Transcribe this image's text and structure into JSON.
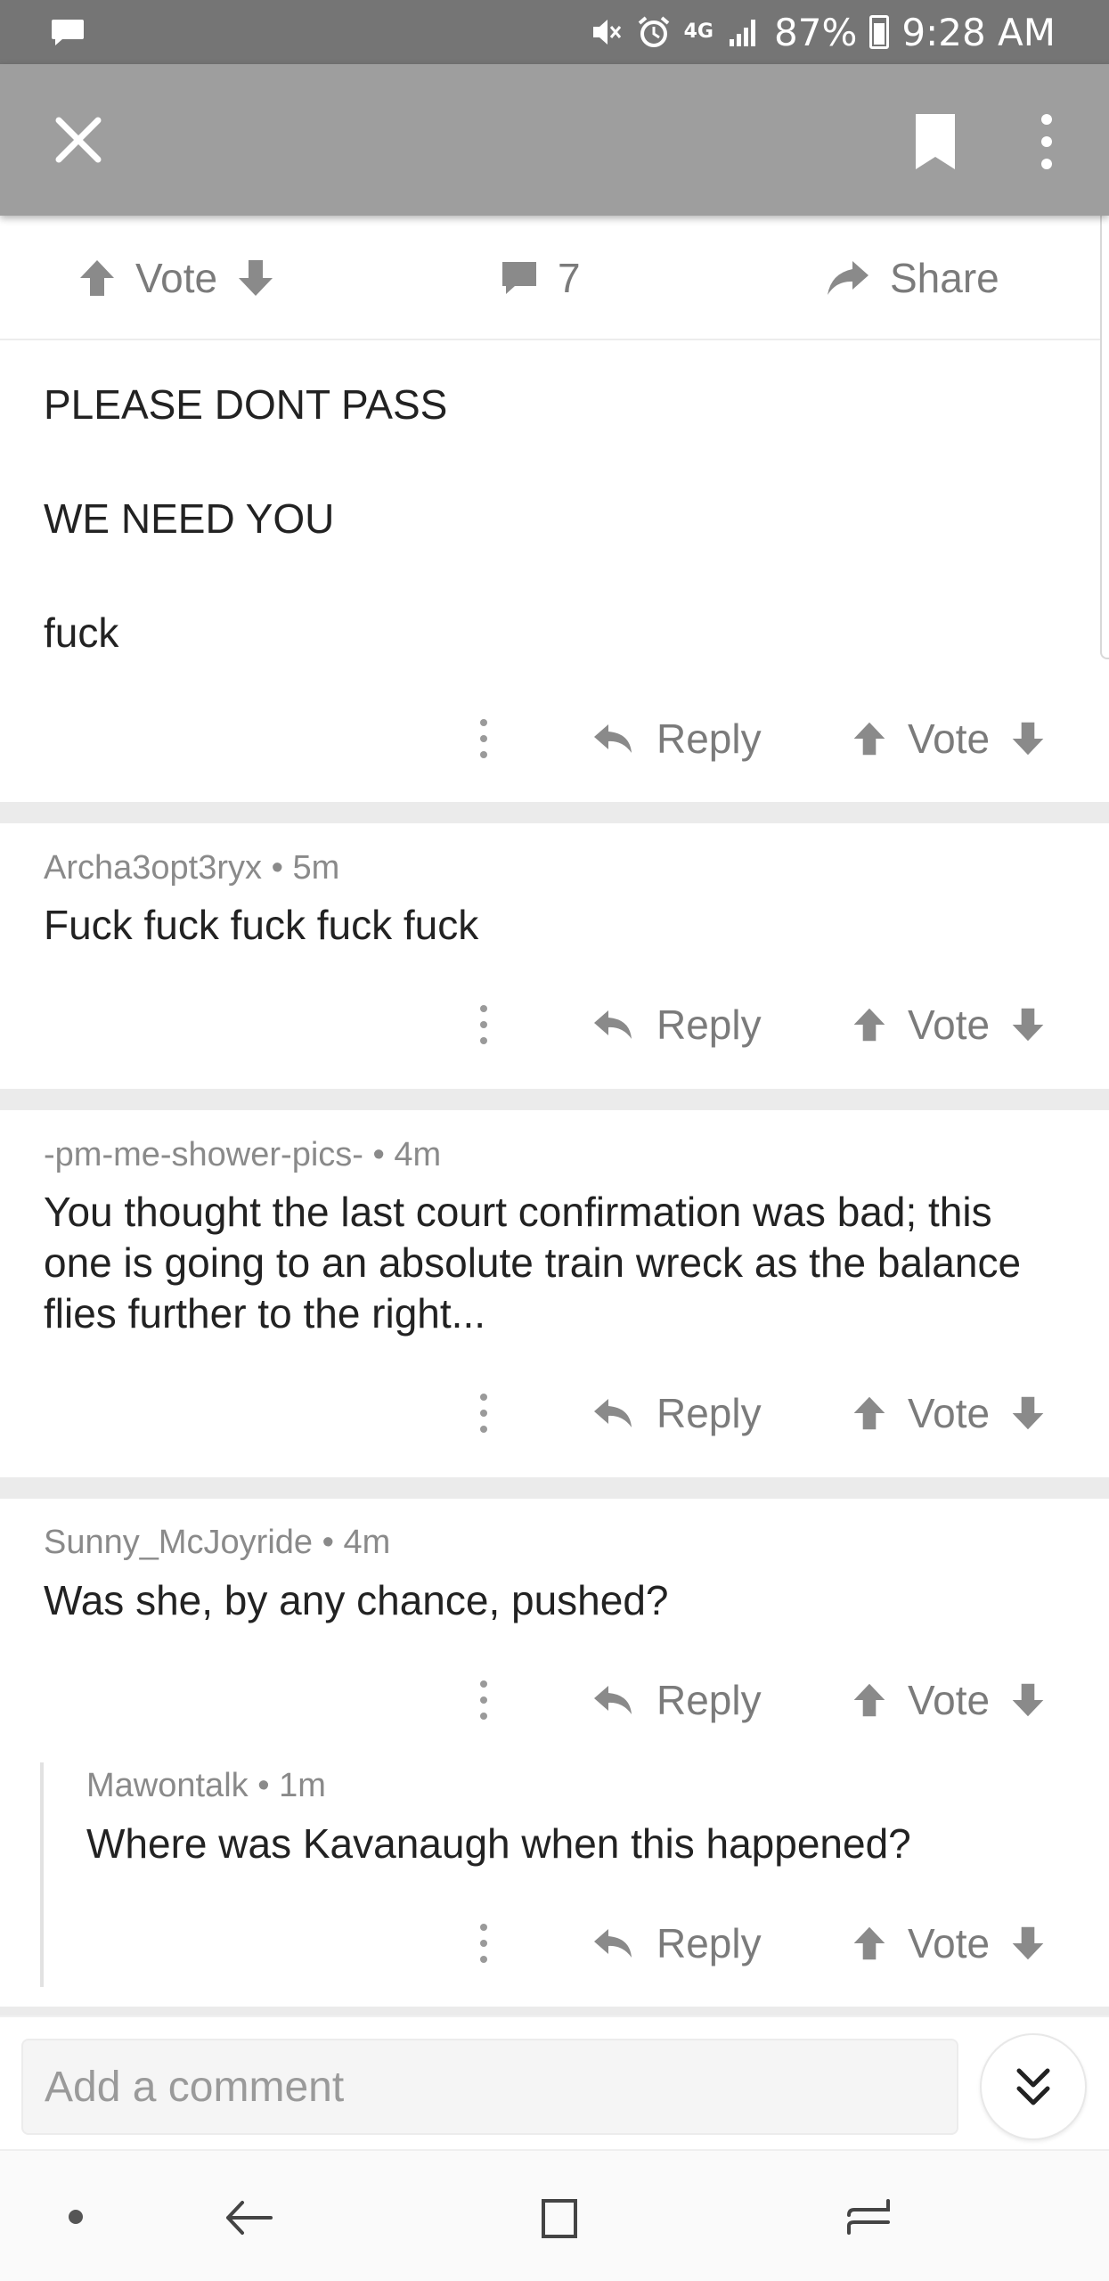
{
  "status_bar": {
    "network": "4G",
    "battery": "87%",
    "time": "9:28 AM",
    "icons": [
      "message-notification-icon",
      "mute-icon",
      "alarm-icon",
      "signal-icon",
      "battery-icon"
    ]
  },
  "app_bar": {
    "icons": [
      "close-icon",
      "bookmark-icon",
      "more-vert-icon"
    ]
  },
  "post_actions": {
    "vote_label": "Vote",
    "comment_count": "7",
    "share_label": "Share"
  },
  "post": {
    "lines": [
      "PLEASE DONT PASS",
      "WE NEED YOU",
      "fuck"
    ]
  },
  "comment_actions": {
    "reply_label": "Reply",
    "vote_label": "Vote"
  },
  "comments": [
    {
      "author": "Archa3opt3ryx",
      "age": "5m",
      "text": "Fuck fuck fuck fuck fuck"
    },
    {
      "author": "-pm-me-shower-pics-",
      "age": "4m",
      "text": "You thought the last court confirmation was bad; this one is going to an absolute train wreck as the balance flies further to the right..."
    },
    {
      "author": "Sunny_McJoyride",
      "age": "4m",
      "text": "Was she, by any chance, pushed?"
    },
    {
      "author": "Mawontalk",
      "age": "1m",
      "text": "Where was Kavanaugh when this happened?",
      "nested": true
    }
  ],
  "comment_input": {
    "placeholder": "Add a comment",
    "value": ""
  },
  "colors": {
    "status_bar": "#757575",
    "app_bar": "#9e9e9e",
    "action_gray": "#7b7b7b",
    "divider": "#ebebeb"
  }
}
